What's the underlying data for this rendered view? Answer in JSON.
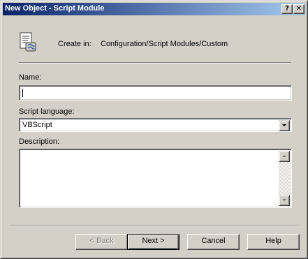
{
  "window": {
    "title": "New Object - Script Module",
    "help_caption": "?",
    "close_caption": "✕"
  },
  "header": {
    "icon": "script-module-icon",
    "create_in_label": "Create in:",
    "create_in_path": "Configuration/Script Modules/Custom"
  },
  "form": {
    "name_label": "Name:",
    "name_value": "",
    "language_label": "Script language:",
    "language_value": "VBScript",
    "description_label": "Description:",
    "description_value": ""
  },
  "buttons": {
    "back": "< Back",
    "next": "Next >",
    "cancel": "Cancel",
    "help": "Help"
  },
  "colors": {
    "face": "#d4d0c8",
    "title_start": "#0a246a",
    "title_end": "#a6caf0"
  }
}
